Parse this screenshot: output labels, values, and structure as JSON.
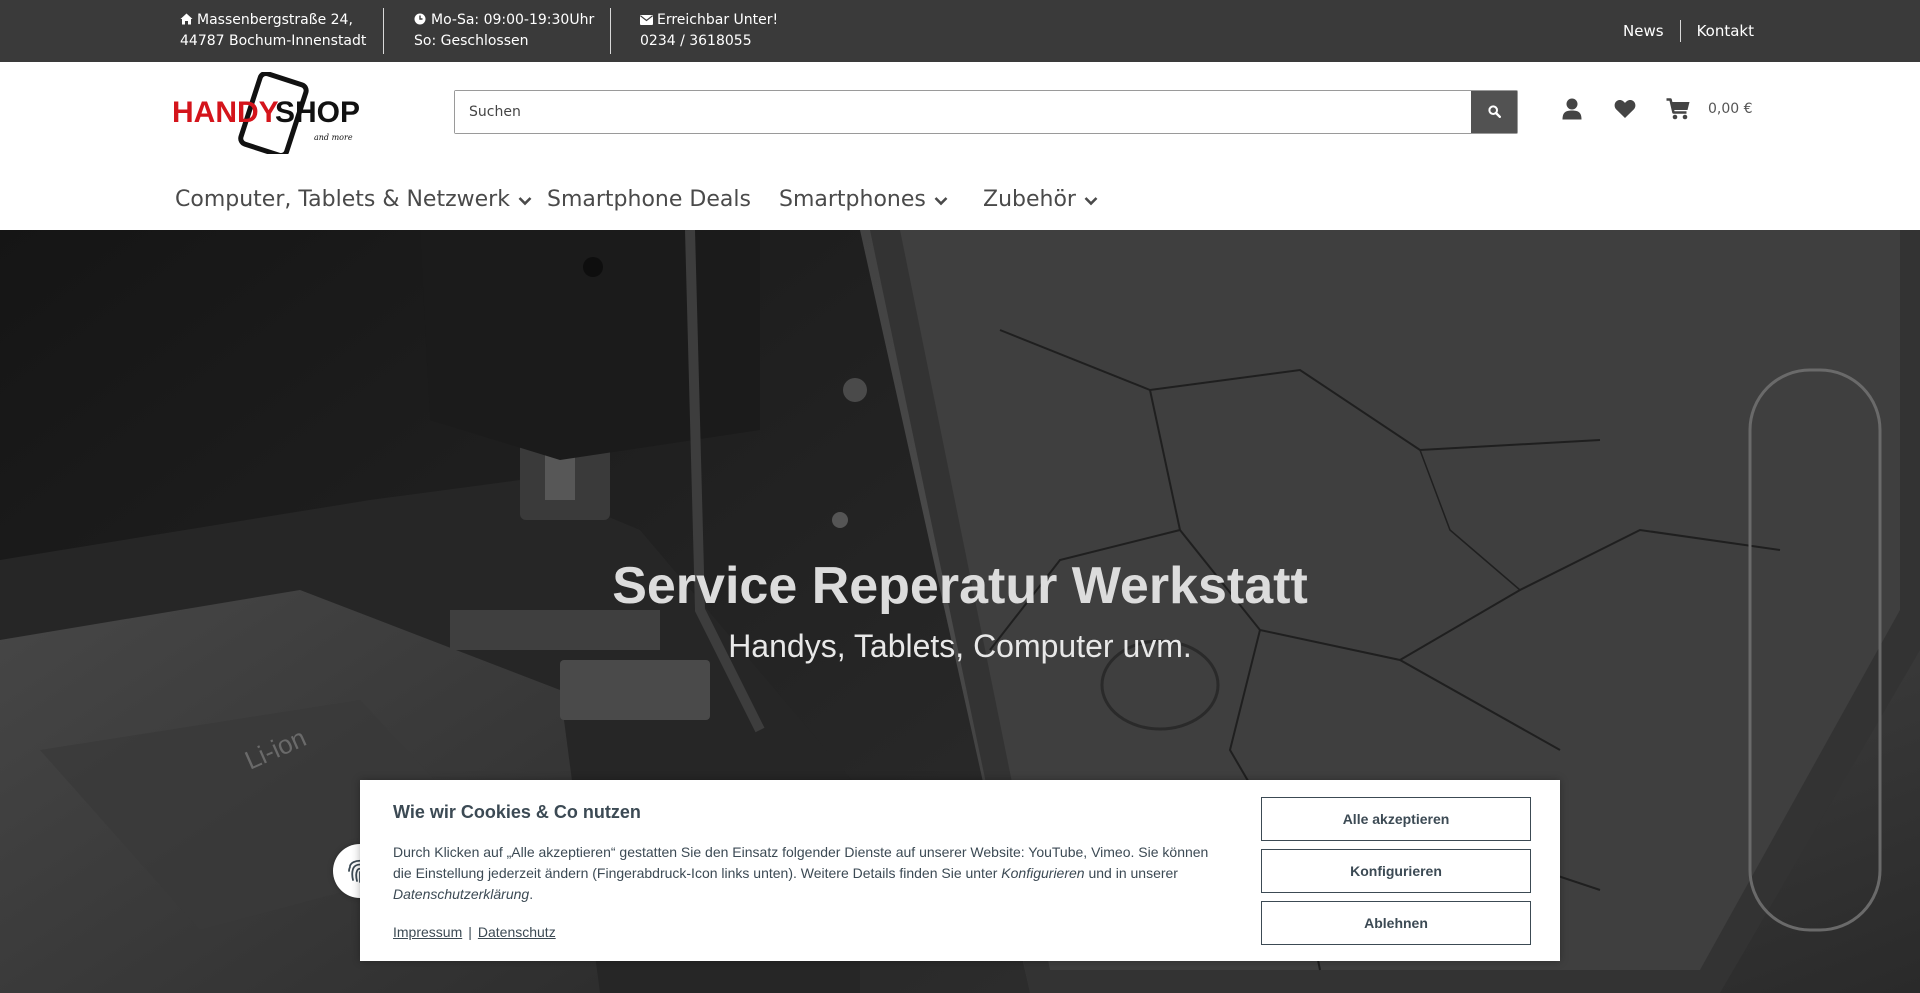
{
  "topbar": {
    "address_line1": "Massenbergstraße 24,",
    "address_line2": "44787 Bochum-Innenstadt",
    "hours_line1": "Mo-Sa: 09:00-19:30Uhr",
    "hours_line2": "So: Geschlossen",
    "contact_line1": "Erreichbar Unter!",
    "contact_line2": "0234 / 3618055",
    "links": [
      "News",
      "Kontakt"
    ]
  },
  "header": {
    "logo_text_1": "HANDY",
    "logo_text_2": "SHOP",
    "logo_tagline": "and more",
    "search_placeholder": "Suchen",
    "cart_total": "0,00 €"
  },
  "nav": {
    "items": [
      "Computer, Tablets & Netzwerk",
      "Smartphone Deals",
      "Smartphones",
      "Zubehör"
    ]
  },
  "hero": {
    "title": "Service Reperatur Werkstatt",
    "subtitle": "Handys, Tablets, Computer uvm."
  },
  "cookie": {
    "title": "Wie wir Cookies & Co nutzen",
    "text_part1": "Durch Klicken auf „Alle akzeptieren“ gestatten Sie den Einsatz folgender Dienste auf unserer Website: YouTube, Vimeo. Sie können die Einstellung jederzeit ändern (Fingerabdruck-Icon links unten). Weitere Details finden Sie unter ",
    "text_em1": "Konfigurieren",
    "text_part2": " und in unserer ",
    "text_em2": "Datenschutzerklärung",
    "text_part3": ".",
    "link_impressum": "Impressum",
    "link_separator": "|",
    "link_datenschutz": "Datenschutz",
    "btn_accept": "Alle akzeptieren",
    "btn_configure": "Konfigurieren",
    "btn_decline": "Ablehnen"
  },
  "icons": {
    "address": "home-icon",
    "hours": "clock-icon",
    "contact": "envelope-icon",
    "search": "search-icon",
    "account": "user-icon",
    "wishlist": "heart-icon",
    "cart": "cart-icon",
    "dropdown": "chevron-down-icon",
    "consent": "fingerprint-icon"
  }
}
